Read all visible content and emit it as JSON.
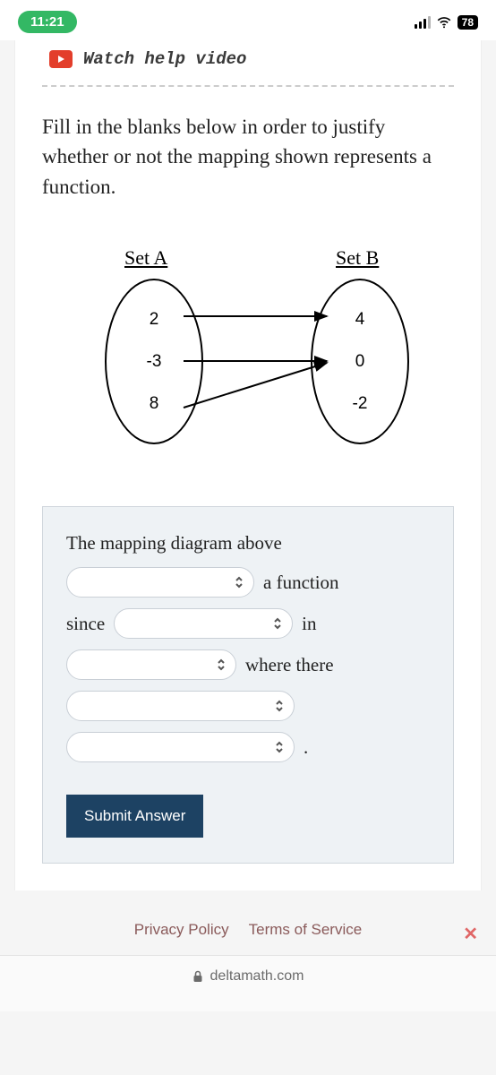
{
  "status": {
    "time": "11:21",
    "battery": "78"
  },
  "watch": {
    "label": "Watch help video"
  },
  "prompt": "Fill in the blanks below in order to justify whether or not the mapping shown represents a function.",
  "diagram": {
    "set_a_label": "Set A",
    "set_b_label": "Set B",
    "set_a": [
      "2",
      "-3",
      "8"
    ],
    "set_b": [
      "4",
      "0",
      "-2"
    ],
    "mappings": [
      {
        "from": "2",
        "to": "4"
      },
      {
        "from": "-3",
        "to": "0"
      },
      {
        "from": "8",
        "to": "0"
      }
    ]
  },
  "answer": {
    "line0": "The mapping diagram above",
    "after_sel1": "a function",
    "since": "since",
    "after_sel2": "in",
    "after_sel3": "where there",
    "period": "."
  },
  "submit_label": "Submit Answer",
  "footer": {
    "privacy": "Privacy Policy",
    "terms": "Terms of Service"
  },
  "url": "deltamath.com"
}
